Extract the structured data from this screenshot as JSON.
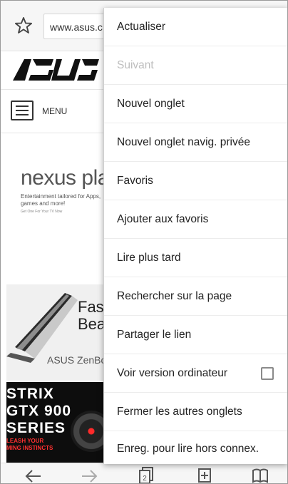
{
  "browser": {
    "url": "www.asus.c",
    "bookmark_icon": "star-icon"
  },
  "page": {
    "logo_text": "/ISUS",
    "menu_label": "MENU",
    "promo": {
      "title": "nexus play",
      "desc": "Entertainment tailored for Apps, games and more!",
      "small": "Get One For Your TV Now"
    },
    "laptop_ad": {
      "line1": "Fast",
      "line2": "Beau",
      "brand": "ASUS ZenBoo"
    },
    "strix_ad": {
      "line1": "STRIX",
      "line2": "GTX 900",
      "line3": "SERIES",
      "sub1": "LEASH YOUR",
      "sub2": "MING INSTINCTS"
    }
  },
  "overflow_menu": {
    "items": [
      {
        "label": "Actualiser",
        "enabled": true
      },
      {
        "label": "Suivant",
        "enabled": false
      },
      {
        "label": "Nouvel onglet",
        "enabled": true
      },
      {
        "label": "Nouvel onglet navig. privée",
        "enabled": true
      },
      {
        "label": "Favoris",
        "enabled": true
      },
      {
        "label": "Ajouter aux favoris",
        "enabled": true
      },
      {
        "label": "Lire plus tard",
        "enabled": true
      },
      {
        "label": "Rechercher sur la page",
        "enabled": true
      },
      {
        "label": "Partager le lien",
        "enabled": true
      },
      {
        "label": "Voir version ordinateur",
        "enabled": true,
        "checkbox": false
      },
      {
        "label": "Fermer les autres onglets",
        "enabled": true
      },
      {
        "label": "Enreg. pour lire hors connex.",
        "enabled": true
      }
    ]
  },
  "bottom_bar": {
    "icons": [
      "back-arrow-icon",
      "forward-arrow-icon",
      "tabs-icon",
      "new-tab-icon",
      "bookmarks-icon"
    ],
    "tab_count": "2"
  }
}
